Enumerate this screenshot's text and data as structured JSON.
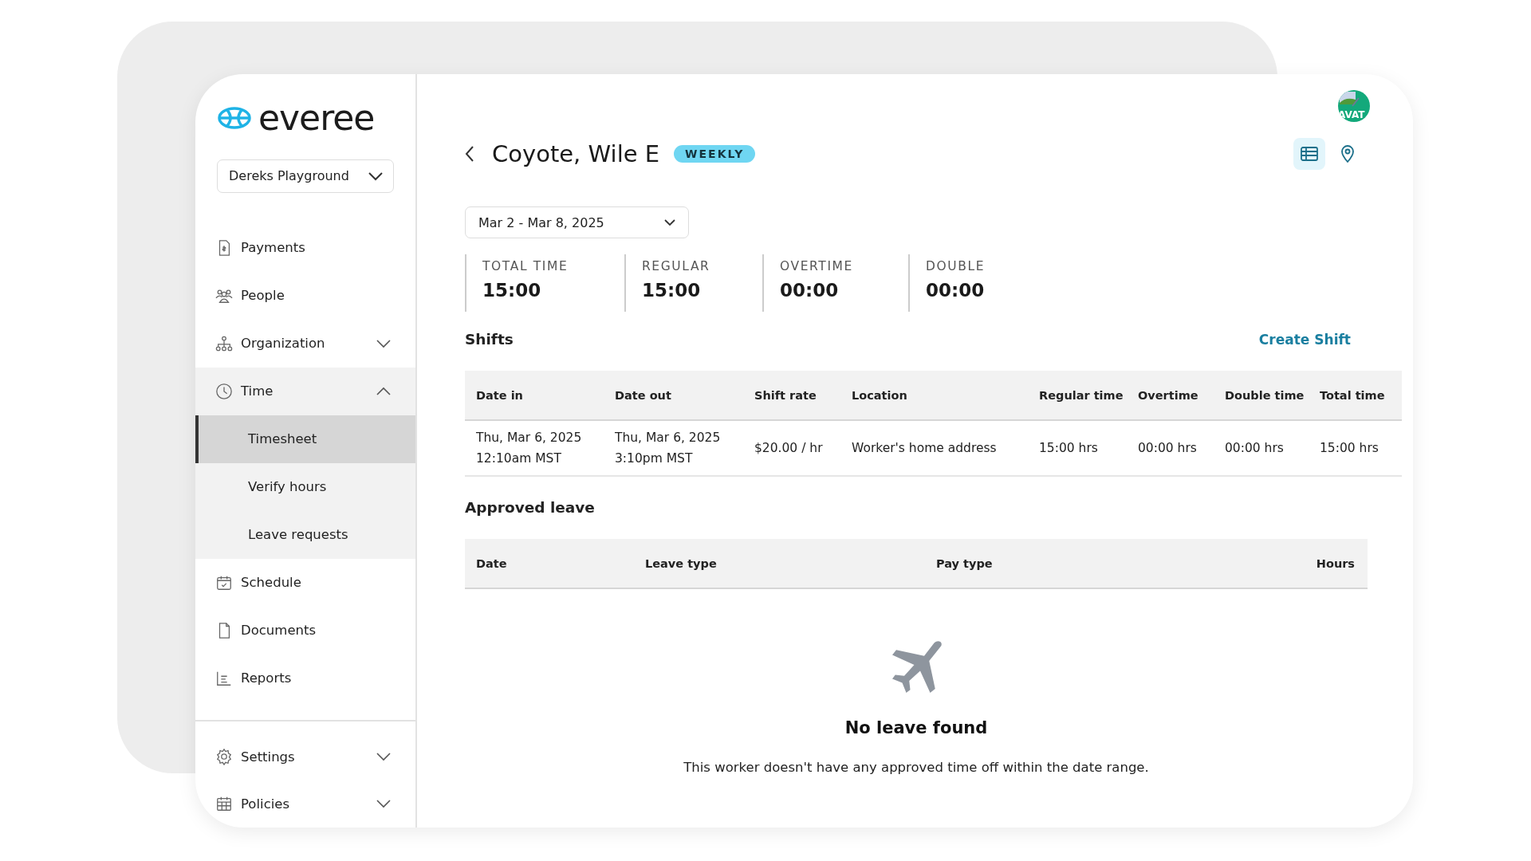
{
  "sidebar": {
    "logo": "everee",
    "org_select": "Dereks Playground",
    "items": [
      {
        "label": "Payments",
        "selected": false
      },
      {
        "label": "People",
        "selected": false
      },
      {
        "label": "Organization",
        "selected": false,
        "expanded": false
      },
      {
        "label": "Time",
        "selected": false,
        "expanded": true,
        "children": [
          {
            "label": "Timesheet",
            "selected": true
          },
          {
            "label": "Verify hours",
            "selected": false
          },
          {
            "label": "Leave requests",
            "selected": false
          }
        ]
      },
      {
        "label": "Schedule",
        "selected": false
      },
      {
        "label": "Documents",
        "selected": false
      },
      {
        "label": "Reports",
        "selected": false
      }
    ],
    "bottom_items": [
      {
        "label": "Settings",
        "selected": false,
        "expanded": false
      },
      {
        "label": "Policies",
        "selected": false,
        "expanded": false
      }
    ]
  },
  "avatar": {
    "text": "AVAT"
  },
  "view_toggle": [
    {
      "selected": true
    },
    {
      "selected": false
    }
  ],
  "header": {
    "title": "Coyote, Wile E",
    "badge": "WEEKLY"
  },
  "date_range": "Mar 2 - Mar 8, 2025",
  "stats": [
    {
      "label": "TOTAL TIME",
      "value": "15:00"
    },
    {
      "label": "REGULAR",
      "value": "15:00"
    },
    {
      "label": "OVERTIME",
      "value": "00:00"
    },
    {
      "label": "DOUBLE",
      "value": "00:00"
    }
  ],
  "shifts": {
    "title": "Shifts",
    "action": "Create Shift",
    "columns": [
      "Date in",
      "Date out",
      "Shift rate",
      "Location",
      "Regular time",
      "Overtime",
      "Double time",
      "Total time"
    ],
    "rows": [
      [
        [
          "Thu, Mar 6, 2025",
          "12:10am MST"
        ],
        [
          "Thu, Mar 6, 2025",
          "3:10pm MST"
        ],
        [
          "$20.00 / hr"
        ],
        [
          "Worker's home address"
        ],
        [
          "15:00 hrs"
        ],
        [
          "00:00 hrs"
        ],
        [
          "00:00 hrs"
        ],
        [
          "15:00 hrs"
        ]
      ]
    ]
  },
  "approved_leave": {
    "title": "Approved leave",
    "columns": [
      "Date",
      "Leave type",
      "Pay type",
      "Hours"
    ],
    "empty": {
      "title": "No leave found",
      "message": "This worker doesn't have any approved time off within the date range."
    }
  }
}
